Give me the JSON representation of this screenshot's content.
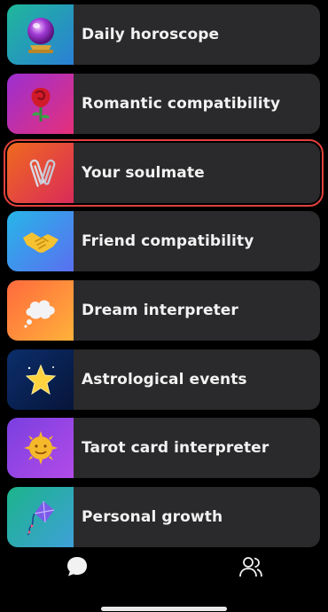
{
  "colors": {
    "background": "#000000",
    "card": "#2a2a2c",
    "selected_outline": "#e1413e",
    "text": "#f2f2f2"
  },
  "items": [
    {
      "label": "Daily horoscope",
      "icon": "crystal-ball-icon",
      "gradient": [
        "#1fb89a",
        "#2b7fd6"
      ]
    },
    {
      "label": "Romantic compatibility",
      "icon": "rose-icon",
      "gradient": [
        "#9b2fd1",
        "#e6307a"
      ]
    },
    {
      "label": "Your soulmate",
      "icon": "paperclips-icon",
      "gradient": [
        "#f06a1e",
        "#d92a5a"
      ]
    },
    {
      "label": "Friend compatibility",
      "icon": "handshake-icon",
      "gradient": [
        "#27b6e8",
        "#5a6ff0"
      ]
    },
    {
      "label": "Dream interpreter",
      "icon": "thought-cloud-icon",
      "gradient": [
        "#ff6a3d",
        "#ffb13b"
      ]
    },
    {
      "label": "Astrological events",
      "icon": "star-icon",
      "gradient": [
        "#0b2e6b",
        "#07153a"
      ]
    },
    {
      "label": "Tarot card interpreter",
      "icon": "sun-face-icon",
      "gradient": [
        "#7a3fe0",
        "#b24be8"
      ]
    },
    {
      "label": "Personal growth",
      "icon": "kite-icon",
      "gradient": [
        "#1bb48a",
        "#3ea0d8"
      ]
    }
  ],
  "selected_index": 2,
  "tabbar": {
    "left_icon": "chat-bubble-icon",
    "right_icon": "users-icon"
  }
}
